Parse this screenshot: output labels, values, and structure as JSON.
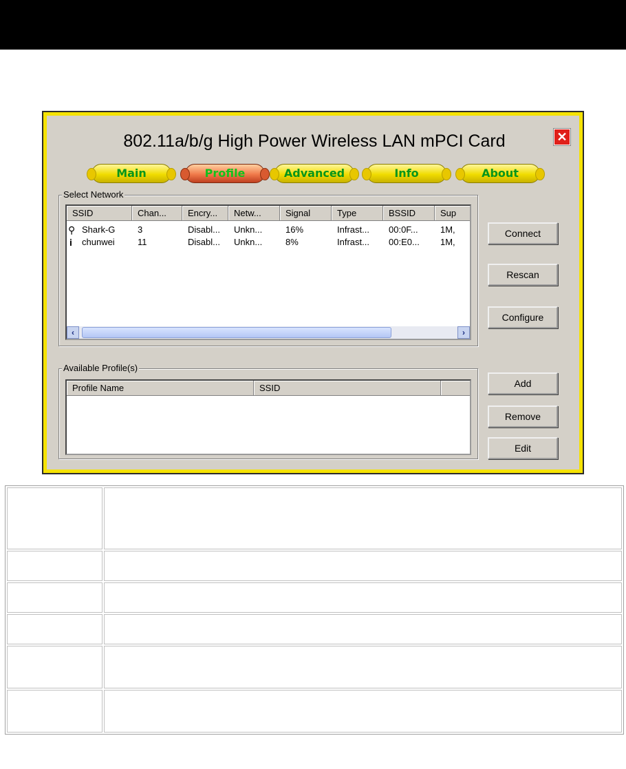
{
  "dialog": {
    "title": "802.11a/b/g High Power Wireless LAN mPCI Card",
    "close_icon": "close-icon",
    "colors": {
      "frame": "#f5e200",
      "tab": "#f0dc00",
      "active_tab": "#f07a4a",
      "tab_text": "#07951b",
      "close": "#e0201a"
    }
  },
  "tabs": [
    {
      "label": "Main"
    },
    {
      "label": "Profile",
      "active": true
    },
    {
      "label": "Advanced"
    },
    {
      "label": "Info"
    },
    {
      "label": "About"
    }
  ],
  "select_network": {
    "label": "Select Network",
    "columns": [
      "SSID",
      "Chan...",
      "Encry...",
      "Netw...",
      "Signal",
      "Type",
      "BSSID",
      "Sup"
    ],
    "rows": [
      {
        "icon": "antenna-icon",
        "cells": [
          "Shark-G",
          "3",
          "Disabl...",
          "Unkn...",
          "16%",
          "Infrast...",
          "00:0F...",
          "1M,"
        ]
      },
      {
        "icon": "access-point-icon",
        "cells": [
          "chunwei",
          "11",
          "Disabl...",
          "Unkn...",
          "8%",
          "Infrast...",
          "00:E0...",
          "1M,"
        ]
      }
    ]
  },
  "available_profiles": {
    "label": "Available Profile(s)",
    "columns": [
      "Profile Name",
      "SSID"
    ]
  },
  "buttons": {
    "connect": "Connect",
    "rescan": "Rescan",
    "configure": "Configure",
    "add": "Add",
    "remove": "Remove",
    "edit": "Edit"
  }
}
